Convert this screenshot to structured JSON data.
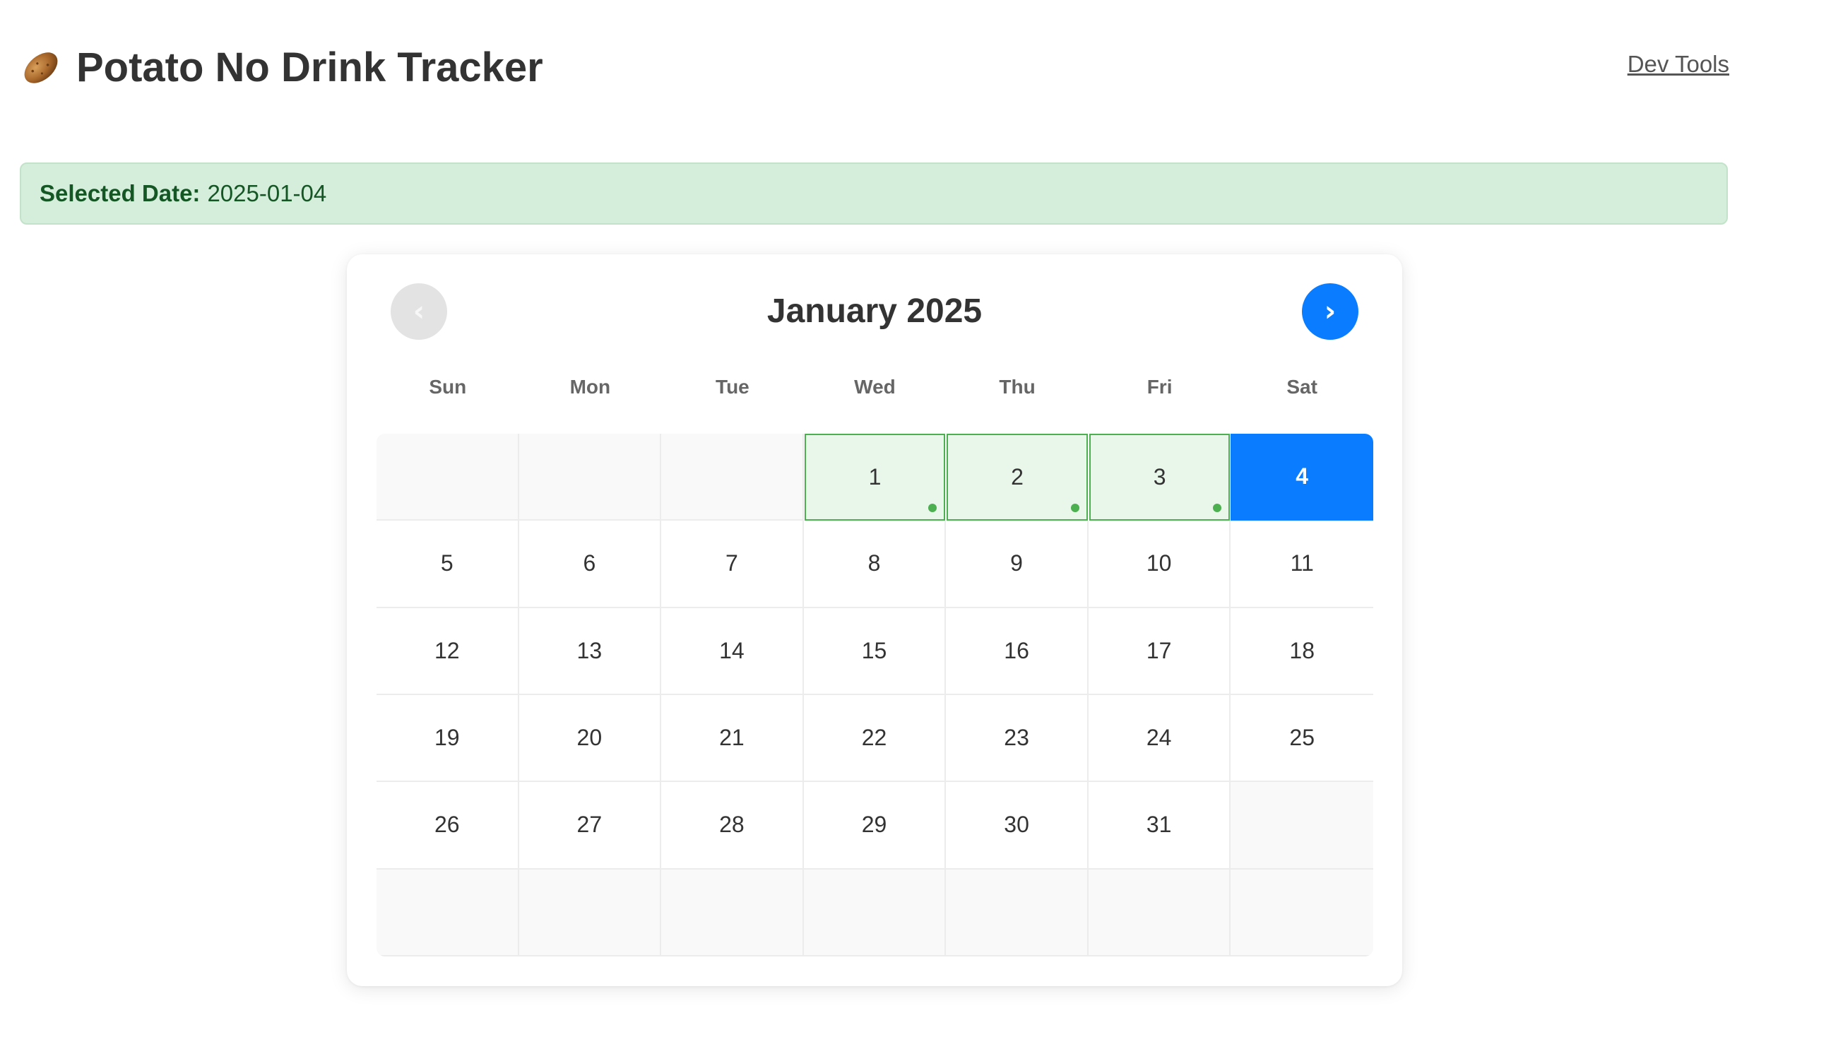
{
  "app": {
    "title": "Potato No Drink Tracker",
    "title_icon": "potato-icon",
    "dev_tools_label": "Dev Tools"
  },
  "banner": {
    "label": "Selected Date:",
    "value": "2025-01-04"
  },
  "calendar": {
    "month_title": "January 2025",
    "prev_label": "‹",
    "next_label": "›",
    "weekdays": [
      "Sun",
      "Mon",
      "Tue",
      "Wed",
      "Thu",
      "Fri",
      "Sat"
    ],
    "leading_empty": 3,
    "days_in_month": 31,
    "total_cells": 42,
    "tracked_days": [
      1,
      2,
      3
    ],
    "selected_day": 4
  },
  "colors": {
    "accent": "#0a7cff",
    "tracked_border": "#4caf50",
    "tracked_fill": "#e9f6ea",
    "banner_fill": "#d5eddb",
    "banner_text": "#155724"
  }
}
